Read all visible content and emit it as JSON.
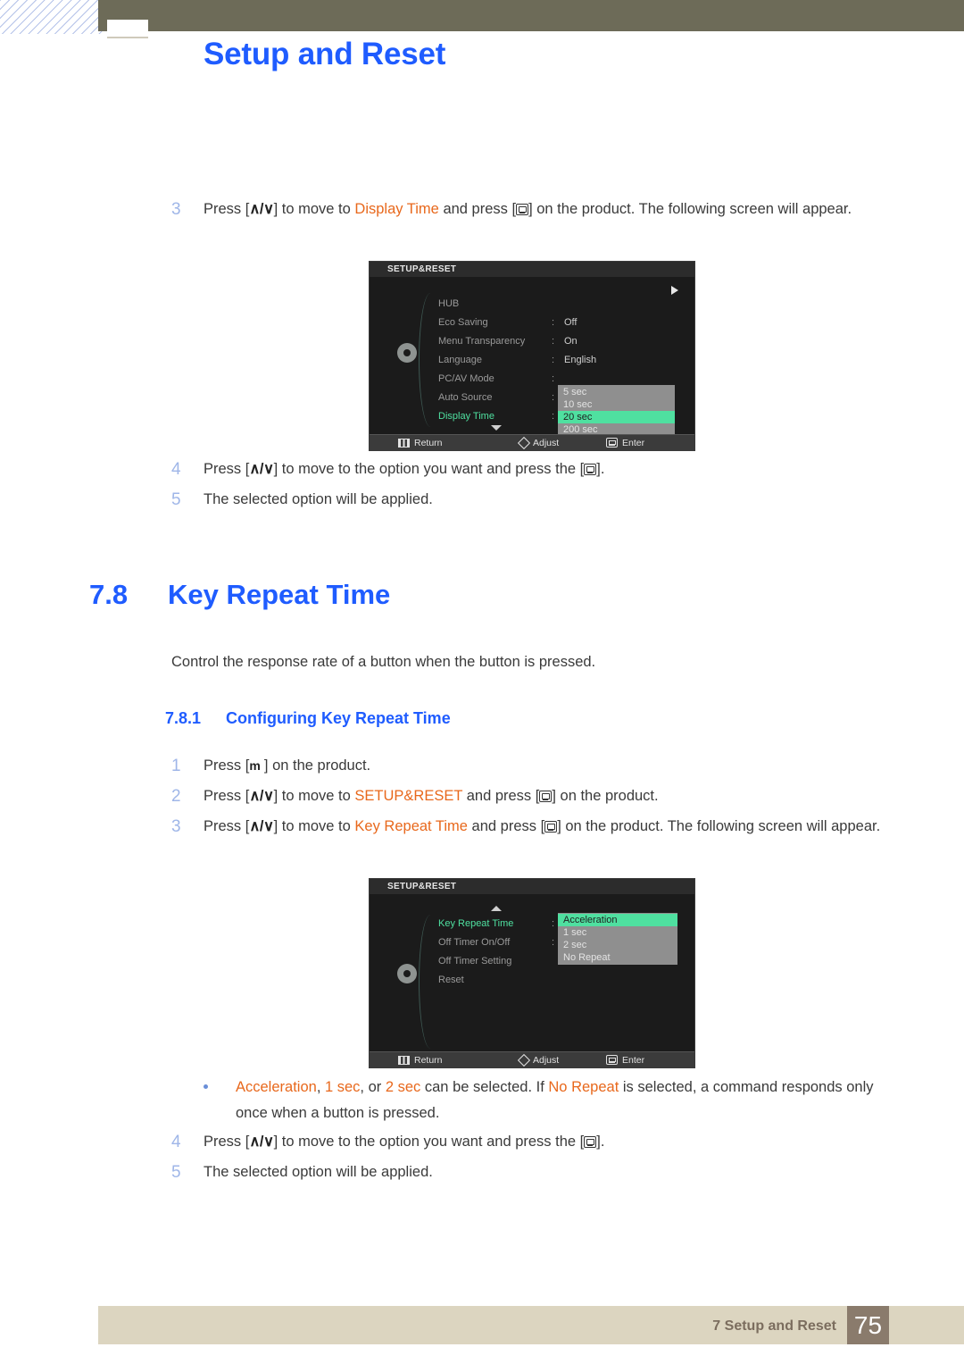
{
  "header": {
    "title": "Setup and Reset"
  },
  "step3_top": {
    "number": "3",
    "text_a": "Press [",
    "keys": "∧/∨",
    "text_b": "] to move to ",
    "highlight": "Display Time",
    "text_c": " and press [",
    "text_d": "] on the product. The following screen will appear."
  },
  "osd1": {
    "title": "SETUP&RESET",
    "items": [
      {
        "label": "HUB",
        "value": "",
        "colon": false,
        "selected": false
      },
      {
        "label": "Eco Saving",
        "value": "Off",
        "colon": true,
        "selected": false
      },
      {
        "label": "Menu Transparency",
        "value": "On",
        "colon": true,
        "selected": false
      },
      {
        "label": "Language",
        "value": "English",
        "colon": true,
        "selected": false
      },
      {
        "label": "PC/AV Mode",
        "value": "",
        "colon": true,
        "selected": false
      },
      {
        "label": "Auto Source",
        "value": "",
        "colon": true,
        "selected": false
      },
      {
        "label": "Display Time",
        "value": "",
        "colon": true,
        "selected": true
      }
    ],
    "dropdown": {
      "options": [
        "5 sec",
        "10 sec",
        "20 sec",
        "200 sec"
      ],
      "active": "20 sec"
    },
    "footer": {
      "return": "Return",
      "adjust": "Adjust",
      "enter": "Enter"
    }
  },
  "step4_top": {
    "number": "4",
    "text_a": "Press [",
    "keys": "∧/∨",
    "text_b": "] to move to the option you want and press the [",
    "text_c": "]."
  },
  "step5_top": {
    "number": "5",
    "text": "The selected option will be applied."
  },
  "section": {
    "number": "7.8",
    "title": "Key Repeat Time",
    "description": "Control the response rate of a button when the button is pressed."
  },
  "subsection": {
    "number": "7.8.1",
    "title": "Configuring Key Repeat Time"
  },
  "step1": {
    "number": "1",
    "text_a": "Press [",
    "key": "m",
    "text_b": " ] on the product."
  },
  "step2": {
    "number": "2",
    "text_a": "Press [",
    "keys": "∧/∨",
    "text_b": "] to move to ",
    "highlight": "SETUP&RESET",
    "text_c": " and press [",
    "text_d": "] on the product."
  },
  "step3": {
    "number": "3",
    "text_a": "Press [",
    "keys": "∧/∨",
    "text_b": "] to move to ",
    "highlight": "Key Repeat Time",
    "text_c": " and press [",
    "text_d": "] on the product. The following screen will appear."
  },
  "osd2": {
    "title": "SETUP&RESET",
    "items": [
      {
        "label": "Key Repeat Time",
        "colon": true,
        "selected": true
      },
      {
        "label": "Off Timer On/Off",
        "colon": true,
        "selected": false
      },
      {
        "label": "Off Timer Setting",
        "colon": false,
        "selected": false
      },
      {
        "label": "Reset",
        "colon": false,
        "selected": false
      }
    ],
    "dropdown": {
      "options": [
        "Acceleration",
        "1 sec",
        "2 sec",
        "No Repeat"
      ],
      "active": "Acceleration"
    },
    "footer": {
      "return": "Return",
      "adjust": "Adjust",
      "enter": "Enter"
    }
  },
  "bullet": {
    "h1": "Acceleration",
    "t1": ", ",
    "h2": "1 sec",
    "t2": ", or ",
    "h3": "2 sec",
    "t3": " can be selected. If ",
    "h4": "No Repeat",
    "t4": " is selected, a command responds only once when a button is pressed."
  },
  "step4": {
    "number": "4",
    "text_a": "Press [",
    "keys": "∧/∨",
    "text_b": "] to move to the option you want and press the [",
    "text_c": "]."
  },
  "step5": {
    "number": "5",
    "text": "The selected option will be applied."
  },
  "footer": {
    "label": "7 Setup and Reset",
    "page": "75"
  },
  "colors": {
    "accent_blue": "#1f5cff",
    "highlight_orange": "#e8681c",
    "header_olive": "#6d6b58",
    "footer_beige": "#dcd5c0",
    "page_box_brown": "#8a7b6c",
    "osd_green": "#4fe0a0"
  }
}
